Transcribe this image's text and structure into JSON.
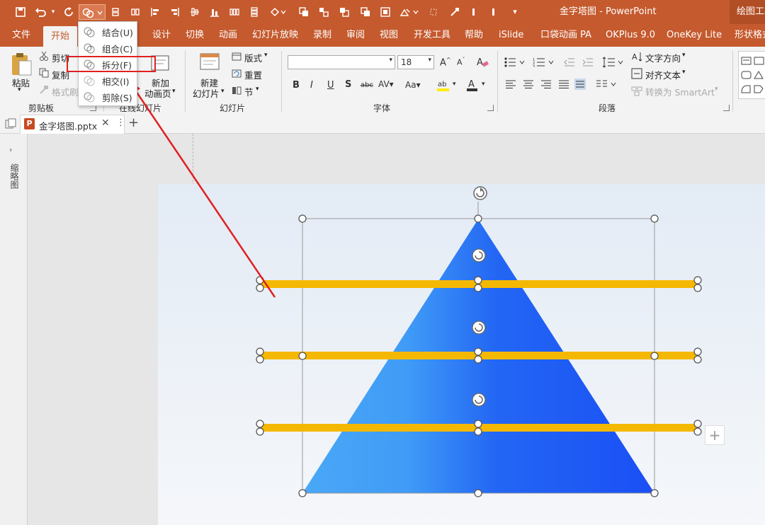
{
  "titlebar": {
    "document_title": "金字塔图 - PowerPoint",
    "context_tab": "绘图工具"
  },
  "tabs": [
    "文件",
    "开始",
    "设计",
    "切换",
    "动画",
    "幻灯片放映",
    "录制",
    "审阅",
    "视图",
    "开发工具",
    "帮助",
    "iSlide",
    "口袋动画 PA",
    "OKPlus 9.0",
    "OneKey Lite",
    "形状格式"
  ],
  "ribbon": {
    "clipboard": {
      "paste": "粘贴",
      "cut": "剪切",
      "copy": "复制",
      "format_painter": "格式刷",
      "group_label": "剪贴板"
    },
    "online_slides": {
      "add": "新加",
      "anim_page": "动画页",
      "group_label": "在线幻灯片"
    },
    "slides": {
      "new": "新建",
      "new2": "幻灯片",
      "layout": "版式",
      "reset": "重置",
      "section": "节",
      "group_label": "幻灯片"
    },
    "font": {
      "font_name": "",
      "font_size": "18",
      "group_label": "字体"
    },
    "paragraph": {
      "text_direction": "文字方向",
      "align_text": "对齐文本",
      "convert_smartart": "转换为 SmartArt",
      "group_label": "段落"
    }
  },
  "dropdown": {
    "items": [
      {
        "label": "结合(U)"
      },
      {
        "label": "组合(C)"
      },
      {
        "label": "拆分(F)"
      },
      {
        "label": "相交(I)"
      },
      {
        "label": "剪除(S)"
      }
    ]
  },
  "docbar": {
    "file_tab": "金字塔图.pptx"
  },
  "sidepanel": {
    "label": "缩略图"
  },
  "colors": {
    "accent": "#c55a2e",
    "pyramid_left": "#4aa8f7",
    "pyramid_right": "#1a4ff5",
    "bar": "#f5b800",
    "annotation": "#e02020"
  }
}
